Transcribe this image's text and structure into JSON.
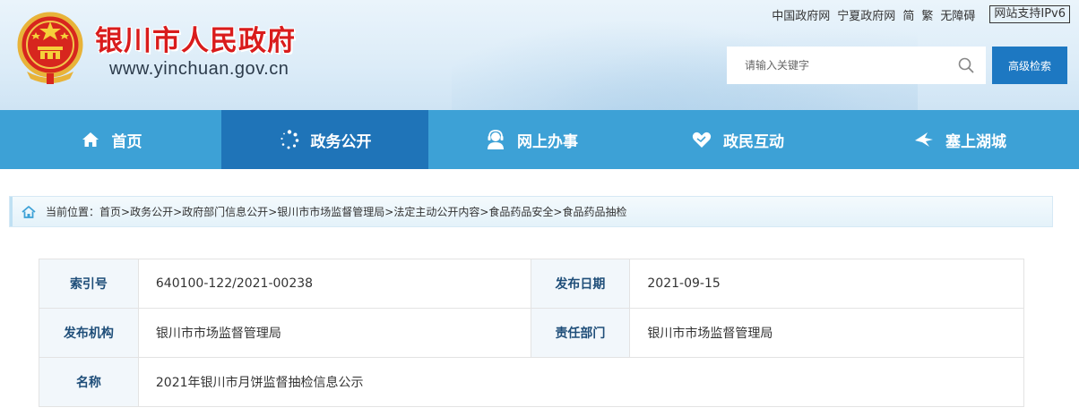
{
  "header": {
    "title": "银川市人民政府",
    "url": "www.yinchuan.gov.cn",
    "toplinks": [
      "中国政府网",
      "宁夏政府网",
      "简",
      "繁",
      "无障碍"
    ],
    "ipv6": "网站支持IPv6",
    "search_placeholder": "请输入关键字",
    "advanced_search": "高级检索"
  },
  "nav": {
    "items": [
      {
        "label": "首页",
        "icon": "home-icon"
      },
      {
        "label": "政务公开",
        "icon": "dots-circle-icon",
        "active": true
      },
      {
        "label": "网上办事",
        "icon": "service-person-icon"
      },
      {
        "label": "政民互动",
        "icon": "heart-hands-icon"
      },
      {
        "label": "塞上湖城",
        "icon": "bird-icon"
      }
    ]
  },
  "breadcrumb": {
    "prefix": "当前位置：",
    "items": [
      "首页",
      "政务公开",
      "政府部门信息公开",
      "银川市市场监督管理局",
      "法定主动公开内容",
      "食品药品安全",
      "食品药品抽检"
    ],
    "separator": ">"
  },
  "info": {
    "index_label": "索引号",
    "index_value": "640100-122/2021-00238",
    "date_label": "发布日期",
    "date_value": "2021-09-15",
    "org_label": "发布机构",
    "org_value": "银川市市场监督管理局",
    "dept_label": "责任部门",
    "dept_value": "银川市市场监督管理局",
    "name_label": "名称",
    "name_value": "2021年银川市月饼监督抽检信息公示"
  },
  "colors": {
    "nav_bg": "#3da1d6",
    "nav_active": "#1f74b8",
    "title_red": "#d91c1c",
    "button_blue": "#1d78c2"
  }
}
